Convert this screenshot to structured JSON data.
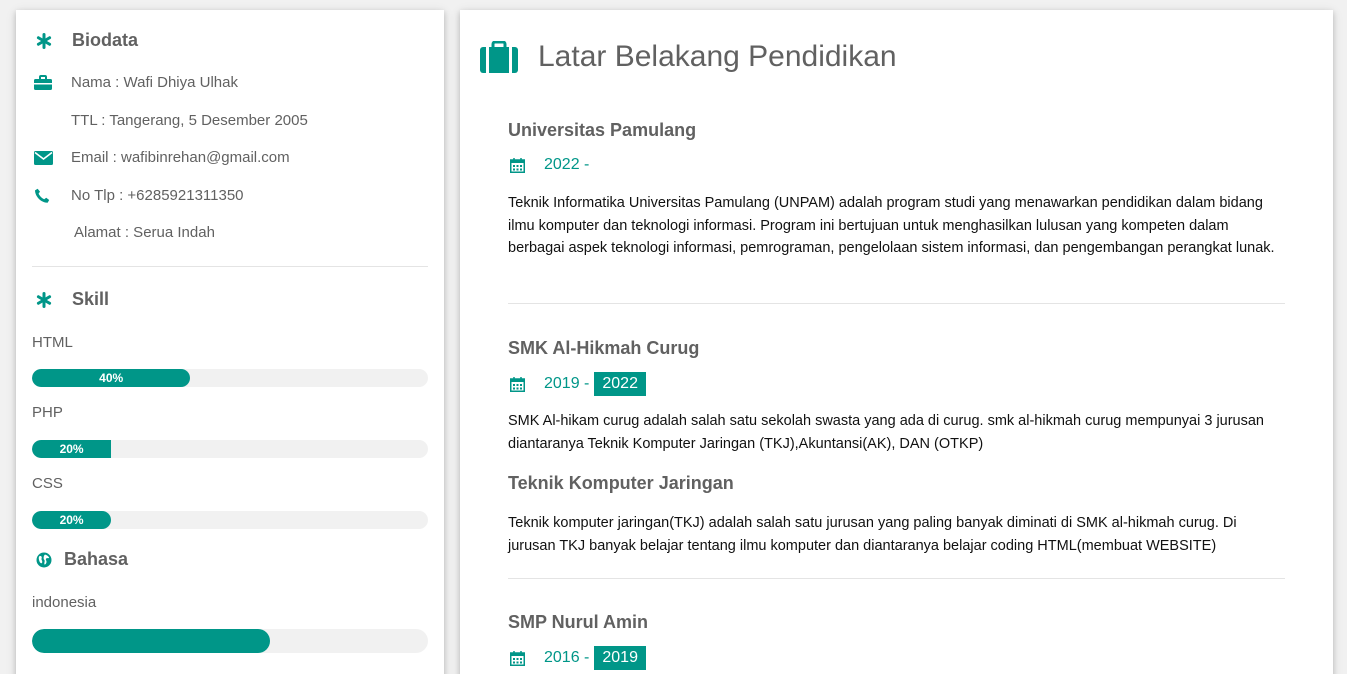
{
  "sidebar": {
    "biodata": {
      "heading": "Biodata",
      "nama": "Nama : Wafi Dhiya Ulhak",
      "ttl": "TTL : Tangerang, 5 Desember 2005",
      "email": "Email : wafibinrehan@gmail.com",
      "phone": "No Tlp : +6285921311350",
      "alamat": "Alamat : Serua Indah"
    },
    "skill": {
      "heading": "Skill",
      "items": [
        {
          "label": "HTML",
          "percent_label": "40%",
          "percent": 40
        },
        {
          "label": "PHP",
          "percent_label": "20%",
          "percent": 20
        },
        {
          "label": "CSS",
          "percent_label": "20%",
          "percent": 20
        }
      ]
    },
    "bahasa": {
      "heading": "Bahasa",
      "items": [
        {
          "label": "indonesia",
          "percent": 60
        }
      ]
    }
  },
  "main": {
    "title": "Latar Belakang Pendidikan",
    "education": [
      {
        "name": "Universitas Pamulang",
        "start": "2022 -",
        "end": "",
        "description": "Teknik Informatika Universitas Pamulang (UNPAM) adalah program studi yang menawarkan pendidikan dalam bidang ilmu komputer dan teknologi informasi. Program ini bertujuan untuk menghasilkan lulusan yang kompeten dalam berbagai aspek teknologi informasi, pemrograman, pengelolaan sistem informasi, dan pengembangan perangkat lunak."
      },
      {
        "name": "SMK Al-Hikmah Curug",
        "start": "2019 -",
        "end": "2022",
        "description": "SMK Al-hikam curug adalah salah satu sekolah swasta yang ada di curug. smk al-hikmah curug mempunyai 3 jurusan diantaranya Teknik Komputer Jaringan (TKJ),Akuntansi(AK), DAN (OTKP)",
        "sub_heading": "Teknik Komputer Jaringan",
        "sub_description": "Teknik komputer jaringan(TKJ) adalah salah satu jurusan yang paling banyak diminati di SMK al-hikmah curug. Di jurusan TKJ banyak belajar tentang ilmu komputer dan diantaranya belajar coding HTML(membuat WEBSITE)"
      },
      {
        "name": "SMP Nurul Amin",
        "start": "2016 -",
        "end": "2019"
      }
    ]
  },
  "colors": {
    "accent": "#009688",
    "text": "#616161",
    "track": "#f1f1f1"
  }
}
